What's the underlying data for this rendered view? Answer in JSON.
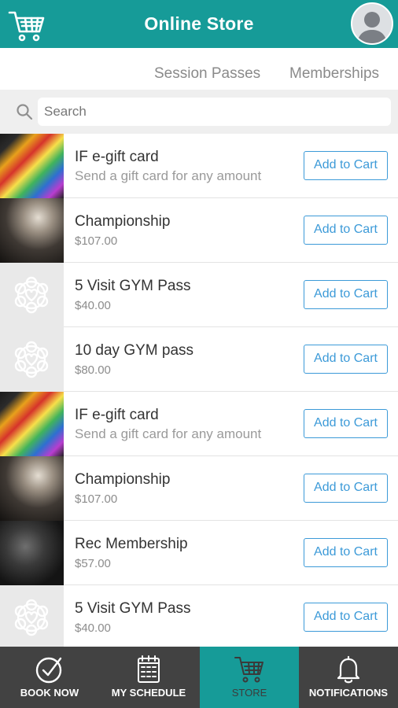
{
  "header": {
    "title": "Online Store",
    "cart_icon": "shopping-cart-icon",
    "avatar_icon": "user-avatar-icon"
  },
  "subtabs": [
    "Session Passes",
    "Memberships"
  ],
  "search": {
    "placeholder": "Search",
    "icon": "search-icon"
  },
  "products": [
    {
      "name": "IF e-gift card",
      "sub": "Send a gift card for any amount",
      "thumb": "gift",
      "button": "Add to Cart"
    },
    {
      "name": "Championship",
      "sub": "$107.00",
      "thumb": "champ",
      "button": "Add to Cart"
    },
    {
      "name": "5 Visit GYM Pass",
      "sub": "$40.00",
      "thumb": "logo",
      "button": "Add to Cart"
    },
    {
      "name": "10 day GYM pass",
      "sub": "$80.00",
      "thumb": "logo",
      "button": "Add to Cart"
    },
    {
      "name": "IF e-gift card",
      "sub": "Send a gift card for any amount",
      "thumb": "gift",
      "button": "Add to Cart"
    },
    {
      "name": "Championship",
      "sub": "$107.00",
      "thumb": "champ",
      "button": "Add to Cart"
    },
    {
      "name": "Rec Membership",
      "sub": "$57.00",
      "thumb": "rec",
      "button": "Add to Cart"
    },
    {
      "name": "5 Visit GYM Pass",
      "sub": "$40.00",
      "thumb": "logo",
      "button": "Add to Cart"
    }
  ],
  "nav": [
    {
      "label": "BOOK NOW",
      "icon": "check-circle-icon"
    },
    {
      "label": "MY SCHEDULE",
      "icon": "calendar-icon"
    },
    {
      "label": "STORE",
      "icon": "store-cart-icon",
      "active": true
    },
    {
      "label": "NOTIFICATIONS",
      "icon": "bell-icon"
    }
  ],
  "colors": {
    "brand": "#169b98",
    "button": "#3c9ad8",
    "nav_bg": "#424242"
  }
}
